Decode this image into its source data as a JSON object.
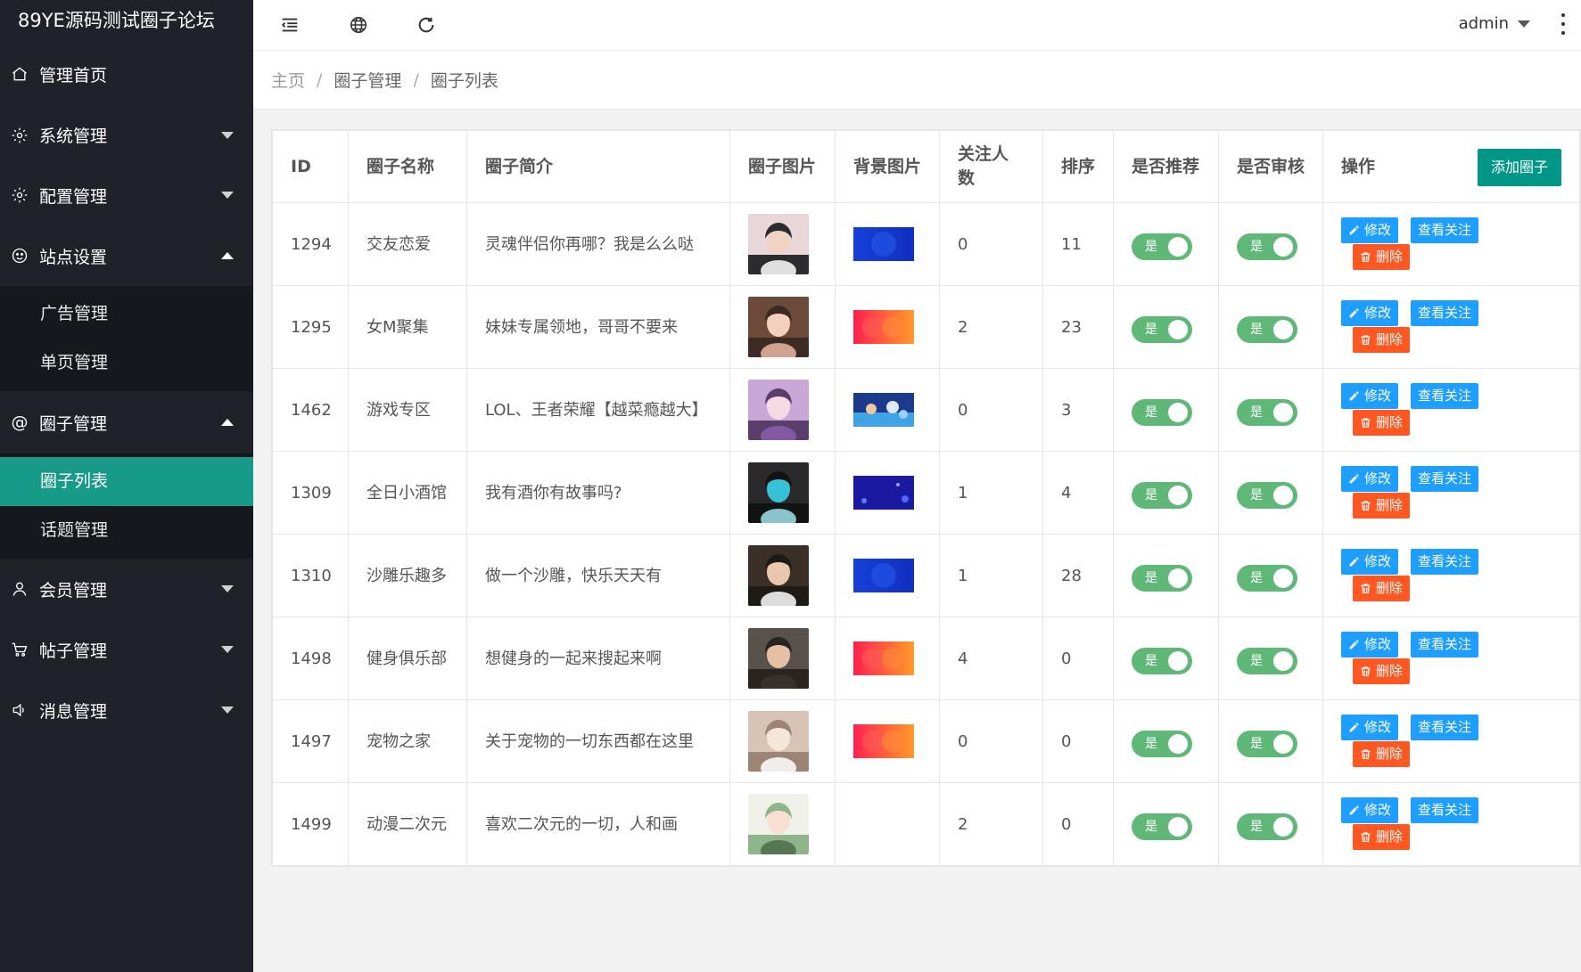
{
  "app": {
    "title": "89YE源码测试圈子论坛"
  },
  "sidebar": {
    "items": [
      {
        "label": "管理首页",
        "icon": "home-icon"
      },
      {
        "label": "系统管理",
        "icon": "gear-icon"
      },
      {
        "label": "配置管理",
        "icon": "gear-icon"
      },
      {
        "label": "站点设置",
        "icon": "smile-icon",
        "expanded": true,
        "children": [
          "广告管理",
          "单页管理"
        ]
      },
      {
        "label": "圈子管理",
        "icon": "at-icon",
        "expanded": true,
        "children": [
          "圈子列表",
          "话题管理"
        ],
        "active_child": "圈子列表"
      },
      {
        "label": "会员管理",
        "icon": "user-icon"
      },
      {
        "label": "帖子管理",
        "icon": "cart-icon"
      },
      {
        "label": "消息管理",
        "icon": "speaker-icon"
      }
    ]
  },
  "header": {
    "user": "admin",
    "icons": [
      "menu-fold-icon",
      "globe-icon",
      "refresh-icon",
      "more-vertical-icon"
    ]
  },
  "breadcrumb": [
    "主页",
    "圈子管理",
    "圈子列表"
  ],
  "table": {
    "columns": [
      "ID",
      "圈子名称",
      "圈子简介",
      "圈子图片",
      "背景图片",
      "关注人数",
      "排序",
      "是否推荐",
      "是否审核",
      "操作"
    ],
    "add_button": "添加圈子",
    "switch_label": "是",
    "actions": {
      "edit": "修改",
      "follow": "查看关注",
      "delete": "删除"
    },
    "rows": [
      {
        "id": "1294",
        "name": "交友恋爱",
        "intro": "灵魂伴侣你再哪？我是么么哒",
        "followers": "0",
        "sort": "11",
        "recommend": true,
        "audited": true,
        "image": "avatar-couple",
        "background": "blue"
      },
      {
        "id": "1295",
        "name": "女M聚集",
        "intro": "妹妹专属领地，哥哥不要来",
        "followers": "2",
        "sort": "23",
        "recommend": true,
        "audited": true,
        "image": "avatar-girl",
        "background": "red-orange"
      },
      {
        "id": "1462",
        "name": "游戏专区",
        "intro": "LOL、王者荣耀【越菜瘾越大】",
        "followers": "0",
        "sort": "3",
        "recommend": true,
        "audited": true,
        "image": "avatar-game-girl",
        "background": "game-art"
      },
      {
        "id": "1309",
        "name": "全日小酒馆",
        "intro": "我有酒你有故事吗?",
        "followers": "1",
        "sort": "4",
        "recommend": true,
        "audited": true,
        "image": "cocktail",
        "background": "dark-blue-dots"
      },
      {
        "id": "1310",
        "name": "沙雕乐趣多",
        "intro": "做一个沙雕，快乐天天有",
        "followers": "1",
        "sort": "28",
        "recommend": true,
        "audited": true,
        "image": "avatar-man-cat",
        "background": "blue"
      },
      {
        "id": "1498",
        "name": "健身俱乐部",
        "intro": "想健身的一起来搜起来啊",
        "followers": "4",
        "sort": "0",
        "recommend": true,
        "audited": true,
        "image": "avatar-young-man",
        "background": "red-orange"
      },
      {
        "id": "1497",
        "name": "宠物之家",
        "intro": "关于宠物的一切东西都在这里",
        "followers": "0",
        "sort": "0",
        "recommend": true,
        "audited": true,
        "image": "kitten",
        "background": "red-orange"
      },
      {
        "id": "1499",
        "name": "动漫二次元",
        "intro": "喜欢二次元的一切，人和画",
        "followers": "2",
        "sort": "0",
        "recommend": true,
        "audited": true,
        "image": "anime-girl",
        "background": ""
      }
    ]
  },
  "colors": {
    "sidebar_bg": "#20222a",
    "active_item": "#179b88",
    "switch_on": "#5fb878",
    "button_primary": "#1e9fff",
    "button_danger": "#ff5722",
    "button_add": "#009688"
  }
}
